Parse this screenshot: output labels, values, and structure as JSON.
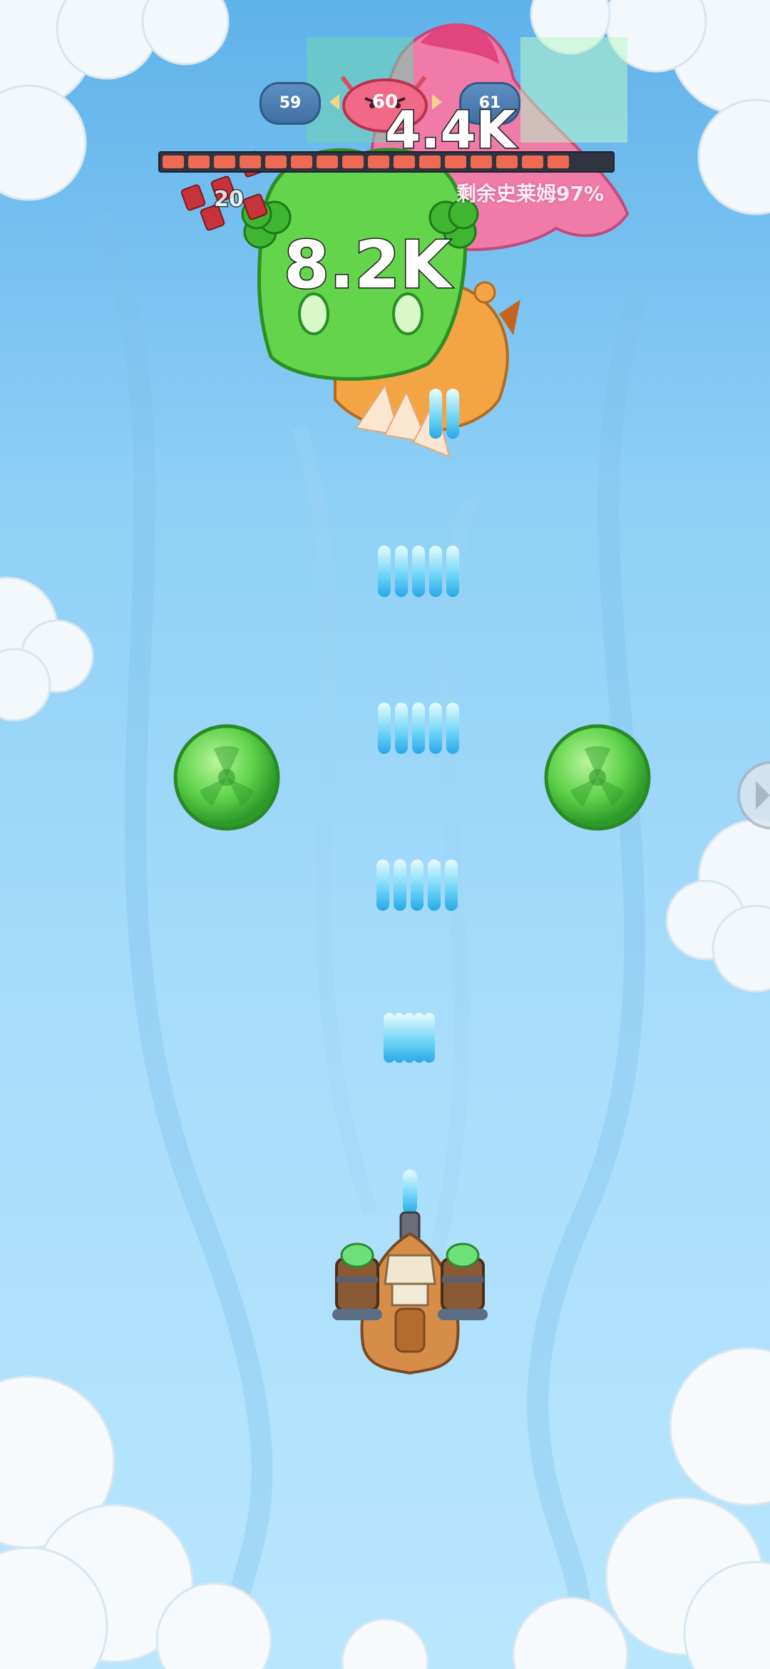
{
  "hud": {
    "level_prev": "59",
    "level_current": "60",
    "level_next": "61",
    "remaining_text": "剩余史莱姆97%",
    "boss_hp_percent": 97,
    "combo_count": "20"
  },
  "damage_numbers": [
    "8.2K",
    "4.4K"
  ],
  "colors": {
    "sky_top": "#5fb2ea",
    "sky_bottom": "#b9e6fd",
    "slime_green": "#5fd24a",
    "slime_pink": "#f06aa0",
    "slime_orange": "#f0a040",
    "bullet": "#48c8f5",
    "hp_bar": "#ef6a52"
  },
  "icons": [
    "angry-slime-icon",
    "left-arrow-icon",
    "right-arrow-icon",
    "radiation-orb-icon",
    "player-ship-icon",
    "coin-bag-icon"
  ]
}
